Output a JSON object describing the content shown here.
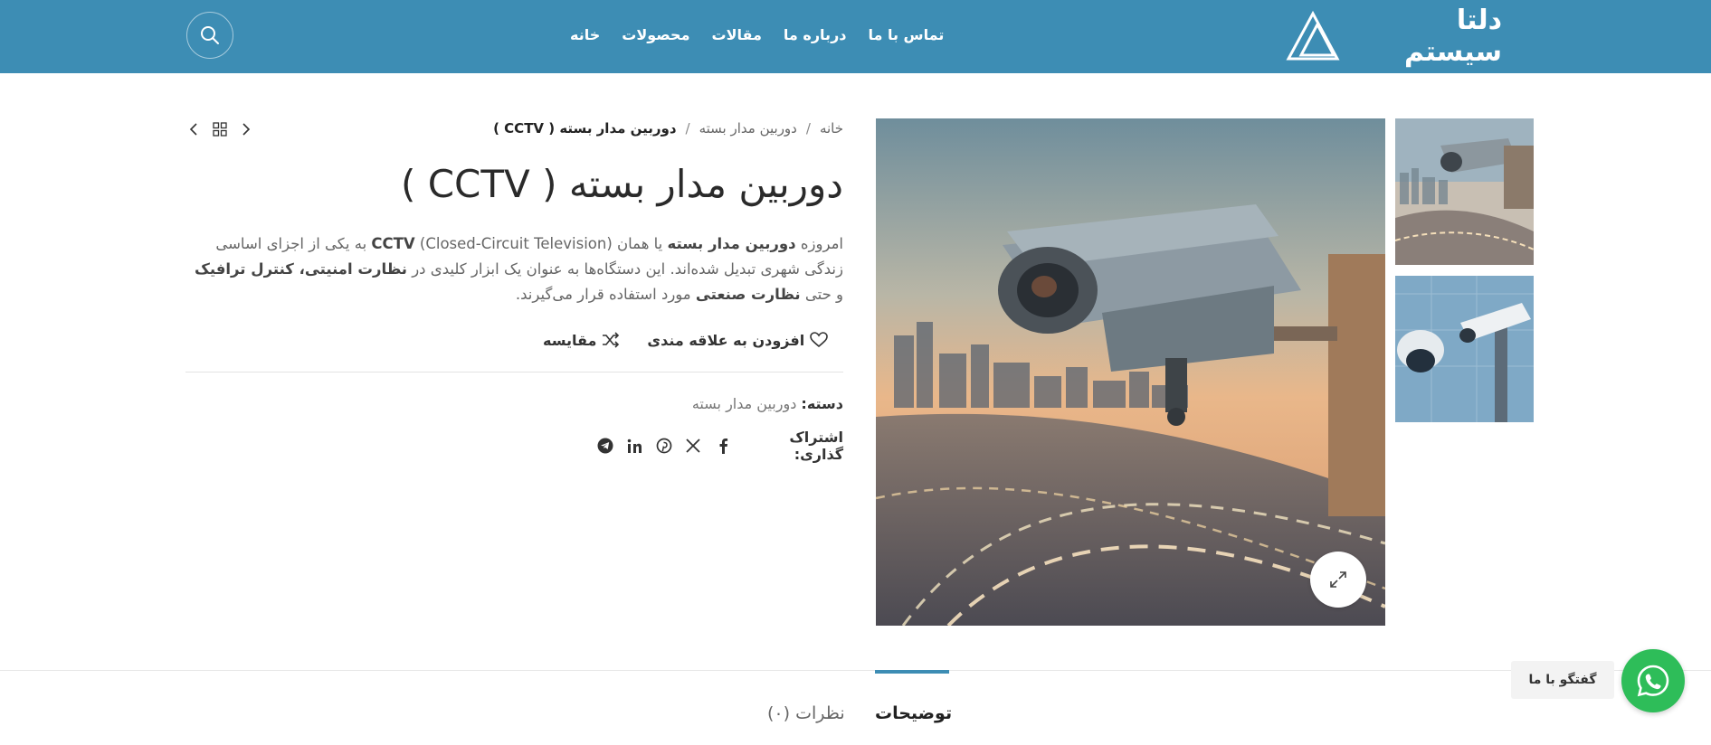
{
  "header": {
    "brand": "دلتا سیستم",
    "nav": [
      "خانه",
      "محصولات",
      "مقالات",
      "درباره ما",
      "تماس با ما"
    ],
    "bg_color": "#3d8db4"
  },
  "breadcrumb": {
    "items": [
      "خانه",
      "دوربین مدار بسته"
    ],
    "separator": "/",
    "current": "دوربین مدار بسته ( CCTV )"
  },
  "product": {
    "title": "دوربین مدار بسته ( CCTV )",
    "description": {
      "p1_a": "امروزه ",
      "p1_b": "دوربین مدار بسته",
      "p1_c": " یا همان ",
      "p1_d": "CCTV",
      "p1_e": " (Closed-Circuit Television)  به یکی از اجزای اساسی زندگی شهری تبدیل شده‌اند. این دستگاه‌ها به عنوان یک ابزار کلیدی در ",
      "p1_f": "نظارت امنیتی، کنترل ترافیک",
      "p1_g": " و حتی ",
      "p1_h": "نظارت صنعتی",
      "p1_i": " مورد استفاده قرار می‌گیرند."
    },
    "compare_label": "مقایسه",
    "wishlist_label": "افزودن به علاقه مندی",
    "category_label": "دسته:",
    "category_value": "دوربین مدار بسته",
    "share_label": "اشتراک گذاری:",
    "share_icons": [
      "facebook-icon",
      "x-icon",
      "pinterest-icon",
      "linkedin-icon",
      "telegram-icon"
    ]
  },
  "tabs": {
    "description": "توضیحات",
    "reviews": "نظرات (۰)"
  },
  "chat": {
    "label": "گفتگو با ما",
    "color": "#2ebd59"
  }
}
